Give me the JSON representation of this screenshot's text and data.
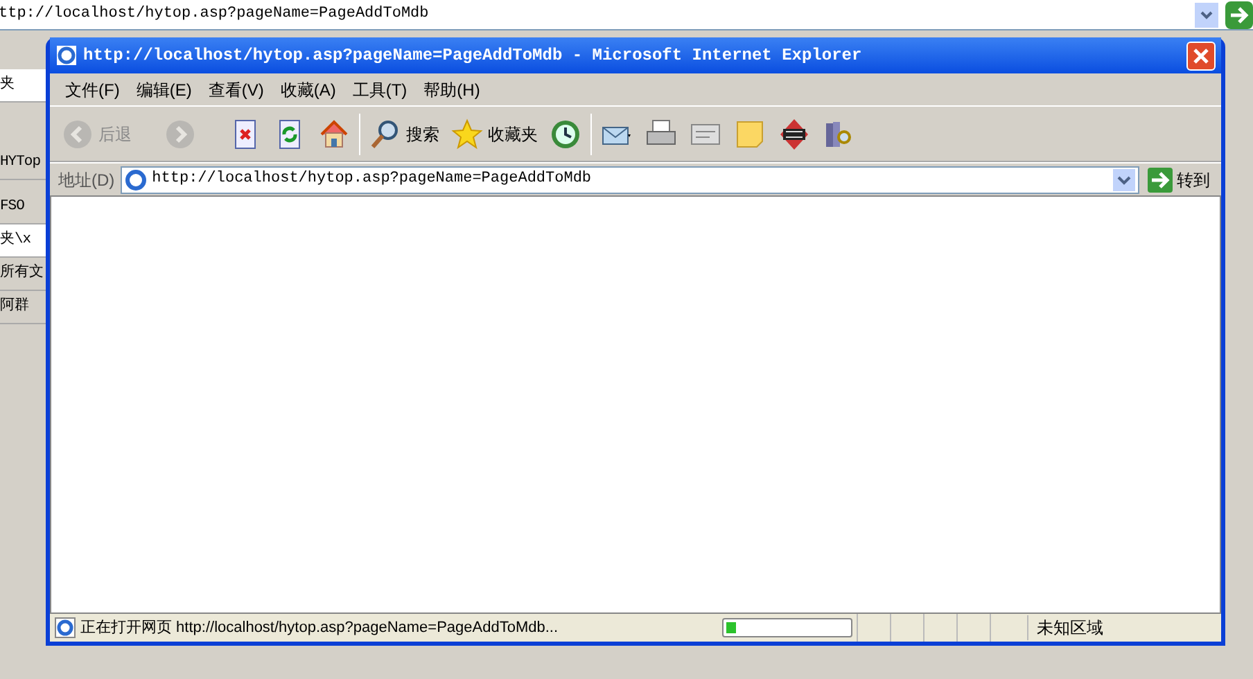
{
  "background_page": {
    "address": "ttp://localhost/hytop.asp?pageName=PageAddToMdb",
    "left_fragments": [
      "夹",
      "HYTop",
      "FSO",
      "夹\\x",
      "所有文",
      "阿群"
    ]
  },
  "window": {
    "title": "http://localhost/hytop.asp?pageName=PageAddToMdb - Microsoft Internet Explorer"
  },
  "menu": [
    "文件(F)",
    "编辑(E)",
    "查看(V)",
    "收藏(A)",
    "工具(T)",
    "帮助(H)"
  ],
  "toolbar": [
    {
      "kind": "back",
      "label": "后退",
      "disabled": true
    },
    {
      "kind": "forward",
      "disabled": true
    },
    {
      "kind": "stop",
      "disabled": false
    },
    {
      "kind": "refresh",
      "disabled": false
    },
    {
      "kind": "home",
      "disabled": false
    },
    {
      "kind": "search",
      "label": "搜索",
      "disabled": false
    },
    {
      "kind": "favorites",
      "label": "收藏夹",
      "disabled": false
    },
    {
      "kind": "history",
      "disabled": false
    },
    {
      "kind": "mail",
      "disabled": false
    },
    {
      "kind": "print",
      "disabled": false
    },
    {
      "kind": "edit",
      "disabled": false
    },
    {
      "kind": "note",
      "disabled": false
    },
    {
      "kind": "game",
      "disabled": false
    },
    {
      "kind": "research",
      "disabled": false
    }
  ],
  "address_bar": {
    "label": "地址(D)",
    "value": "http://localhost/hytop.asp?pageName=PageAddToMdb",
    "go": "转到"
  },
  "status_bar": {
    "text": "正在打开网页 http://localhost/hytop.asp?pageName=PageAddToMdb...",
    "level": 0.08,
    "zone": "未知区域"
  }
}
